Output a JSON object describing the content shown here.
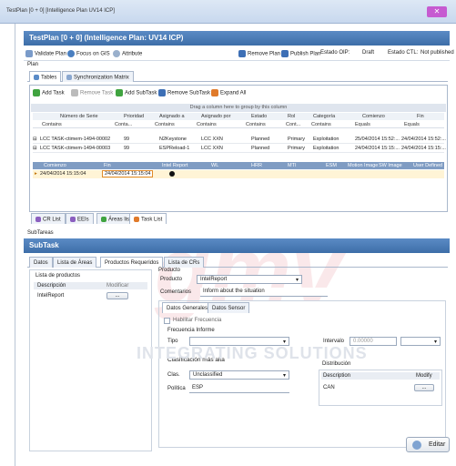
{
  "window": {
    "title": "TestPlan [0 + 0] [Intelligence Plan UV14 ICP]",
    "close": "✕"
  },
  "header": {
    "title": "TestPlan [0 + 0] (Intelligence Plan: UV14 ICP)"
  },
  "toolbar": {
    "validate": "Validate Plan",
    "focus": "Focus on GIS",
    "attribute": "Attribute",
    "remove_plan": "Remove Plan",
    "publish_plan": "Publish Plan",
    "estado_oip_label": "Estado OIP:",
    "estado_oip_value": "Draft",
    "estado_ctl_label": "Estado CTL:",
    "estado_ctl_value": "Not published"
  },
  "plan": {
    "label": "Plan",
    "tab_tables": "Tables",
    "tab_sync": "Synchronization Matrix"
  },
  "grid": {
    "buttons": {
      "add": "Add Task",
      "remove": "Remove Task",
      "add_sub": "Add SubTask",
      "remove_sub": "Remove SubTask",
      "expand": "Expand All"
    },
    "group_hint": "Drag a column here to group by this column",
    "columns": [
      "Número de Serie",
      "Prioridad",
      "Asignado a",
      "Asignado por",
      "Estado",
      "Rol",
      "Categoría",
      "Comienzo",
      "Fin"
    ],
    "filters": [
      "Contains",
      "Conta...",
      "Contains",
      "Contains",
      "Contains",
      "Cont...",
      "Contains",
      "Equals",
      "Equals"
    ],
    "rows": [
      {
        "serie": "LCC TASK-ctimem-1494-00002",
        "prioridad": "99",
        "asignado_a": "N2Keystone",
        "asignado_por": "LCC XXN",
        "estado": "Planned",
        "rol": "Primary",
        "categoria": "Exploitation",
        "comienzo": "25/04/2014 15:52:...",
        "fin": "24/04/2014 15:52:..."
      },
      {
        "serie": "LCC TASK-ctimem-1494-00003",
        "prioridad": "99",
        "asignado_a": "ESPReload-1",
        "asignado_por": "LCC XXN",
        "estado": "Planned",
        "rol": "Primary",
        "categoria": "Exploitation",
        "comienzo": "24/04/2014 15:15:...",
        "fin": "24/04/2014 15:15:..."
      }
    ],
    "child_columns": [
      "Comienzo",
      "Fin",
      "Intel Report",
      "WL",
      "HRR",
      "MTI",
      "ESM",
      "Motion Image",
      "SW Image",
      "User Defined"
    ],
    "child_row": {
      "comienzo": "24/04/2014 15:15:04",
      "fin": "24/04/2014 15:15:04"
    }
  },
  "bottom_tabs": [
    "CR List",
    "EEIs",
    "Áreas list",
    "Task List"
  ],
  "subtareas": {
    "label": "SubTareas",
    "band": "SubTask",
    "tabs": [
      "Datos",
      "Lista de Áreas",
      "Productos Requeridos",
      "Lista de CRs"
    ]
  },
  "productos": {
    "group": "Lista de productos",
    "col_desc": "Descripción",
    "col_mod": "Modificar",
    "item": "IntelReport",
    "btn": "..."
  },
  "producto": {
    "group": "Producto",
    "label": "Producto",
    "value": "IntelReport",
    "comentarios_label": "Comentarios",
    "comentarios_value": "Inform about the situation",
    "tabs": [
      "Datos Generales",
      "Datos Sensor"
    ]
  },
  "datos": {
    "habilitar": "Habilitar Frecuencia",
    "frecuencia": "Frecuencia Informe",
    "tipo": "Tipo",
    "intervalo": "Intervalo",
    "intervalo_value": "0.00000",
    "clasif_group": "Clasificación más alta",
    "clas_label": "Clas.",
    "clas_value": "Unclassified",
    "politica_label": "Política",
    "politica_value": "ESP",
    "distribucion": "Distribución",
    "dist_col_desc": "Description",
    "dist_col_mod": "Modify",
    "dist_item": "CAN",
    "dist_btn": "..."
  },
  "watermark": "INTEGRATING SOLUTIONS",
  "watermark_logo": "gmv",
  "footer": {
    "editar": "Editar"
  }
}
